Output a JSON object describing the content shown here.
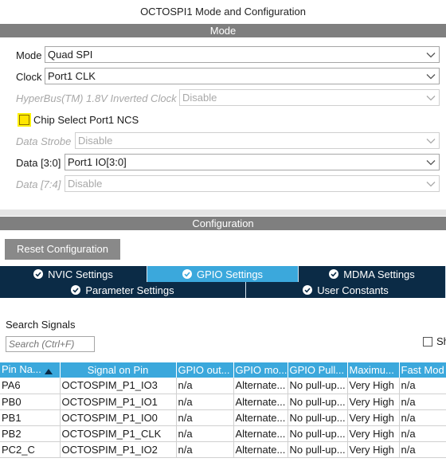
{
  "window": {
    "title": "OCTOSPI1 Mode and Configuration"
  },
  "mode_section": {
    "header": "Mode",
    "fields": [
      {
        "label": "Mode",
        "value": "Quad SPI",
        "disabled": false
      },
      {
        "label": "Clock",
        "value": "Port1 CLK",
        "disabled": false
      },
      {
        "label": "HyperBus(TM) 1.8V Inverted Clock",
        "value": "Disable",
        "disabled": true
      }
    ],
    "checkbox": {
      "label": "Chip Select Port1 NCS",
      "checked": false,
      "highlighted": true
    },
    "fields2": [
      {
        "label": "Data Strobe",
        "value": "Disable",
        "disabled": true
      },
      {
        "label": "Data [3:0]",
        "value": "Port1 IO[3:0]",
        "disabled": false
      },
      {
        "label": "Data [7:4]",
        "value": "Disable",
        "disabled": true
      }
    ]
  },
  "config_section": {
    "header": "Configuration",
    "reset_button": "Reset Configuration",
    "tabs_row1": [
      {
        "label": "NVIC Settings",
        "icon": "check-circle-icon",
        "active": false
      },
      {
        "label": "GPIO Settings",
        "icon": "check-circle-icon",
        "active": true
      },
      {
        "label": "MDMA Settings",
        "icon": "check-circle-icon",
        "active": false
      }
    ],
    "tabs_row2": [
      {
        "label": "Parameter Settings",
        "icon": "check-circle-icon",
        "active": false
      },
      {
        "label": "User Constants",
        "icon": "check-circle-icon",
        "active": false
      }
    ],
    "search": {
      "label": "Search Signals",
      "placeholder": "Search (Ctrl+F)",
      "show_checkbox_label": "Sh"
    },
    "table": {
      "columns": [
        "Pin Na...",
        "Signal on Pin",
        "GPIO out...",
        "GPIO mo...",
        "GPIO Pull...",
        "Maximu...",
        "Fast Mod"
      ],
      "rows": [
        [
          "PA6",
          "OCTOSPIM_P1_IO3",
          "n/a",
          "Alternate...",
          "No pull-up...",
          "Very High",
          "n/a"
        ],
        [
          "PB0",
          "OCTOSPIM_P1_IO1",
          "n/a",
          "Alternate...",
          "No pull-up...",
          "Very High",
          "n/a"
        ],
        [
          "PB1",
          "OCTOSPIM_P1_IO0",
          "n/a",
          "Alternate...",
          "No pull-up...",
          "Very High",
          "n/a"
        ],
        [
          "PB2",
          "OCTOSPIM_P1_CLK",
          "n/a",
          "Alternate...",
          "No pull-up...",
          "Very High",
          "n/a"
        ],
        [
          "PC2_C",
          "OCTOSPIM_P1_IO2",
          "n/a",
          "Alternate...",
          "No pull-up...",
          "Very High",
          "n/a"
        ]
      ]
    }
  },
  "colors": {
    "section_bar": "#7f7f7f",
    "tab_dark": "#0b2b46",
    "tab_active": "#3ba8dc",
    "table_header": "#3ba8dc",
    "checkbox_highlight": "#ffe600"
  }
}
